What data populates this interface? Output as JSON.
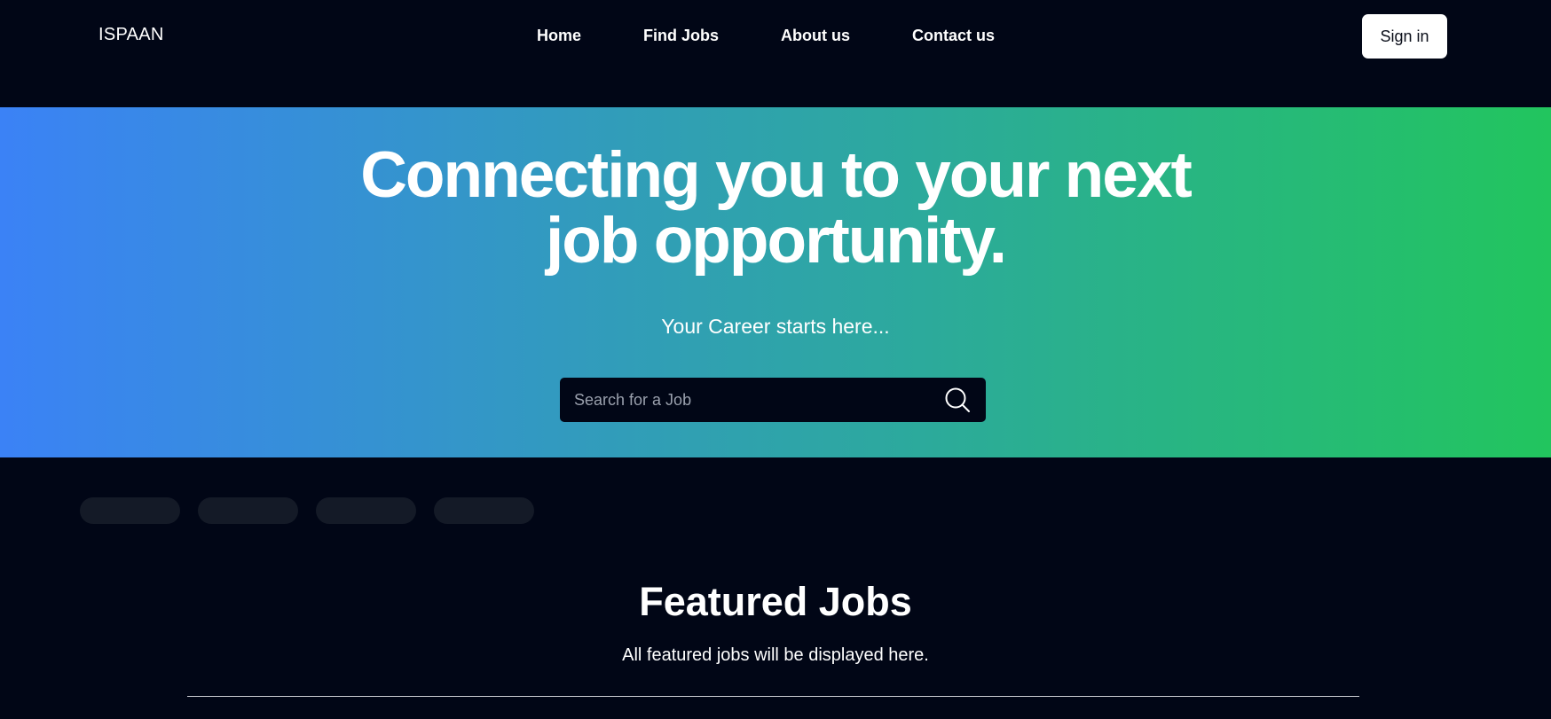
{
  "navbar": {
    "brand": "ISPAAN",
    "links": [
      {
        "label": "Home"
      },
      {
        "label": "Find Jobs"
      },
      {
        "label": "About us"
      },
      {
        "label": "Contact us"
      }
    ],
    "signin_label": "Sign in"
  },
  "hero": {
    "title_line1": "Connecting you to your next",
    "title_line2": "job opportunity.",
    "subtitle": "Your Career starts here...",
    "gradient_start": "#3b82f6",
    "gradient_end": "#22c55e",
    "search": {
      "placeholder": "Search for a Job",
      "value": "",
      "icon": "search-icon"
    }
  },
  "categories": {
    "pills": [
      {
        "label": ""
      },
      {
        "label": ""
      },
      {
        "label": ""
      },
      {
        "label": ""
      }
    ]
  },
  "featured": {
    "title": "Featured Jobs",
    "subtitle": "All featured jobs will be displayed here."
  },
  "colors": {
    "background": "#010616",
    "pill": "#141a27",
    "signin_bg": "#ffffff"
  }
}
